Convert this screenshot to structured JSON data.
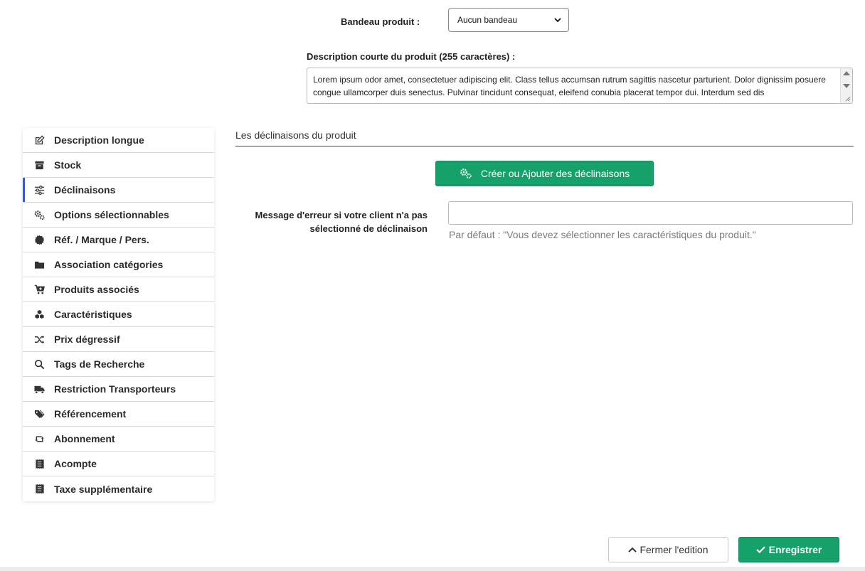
{
  "form": {
    "banner_label": "Bandeau produit :",
    "banner_value": "Aucun bandeau",
    "short_desc_label": "Description courte du produit (255 caractères) :",
    "short_desc_value": "Lorem ipsum odor amet, consectetuer adipiscing elit. Class tellus accumsan rutrum sagittis nascetur parturient. Dolor dignissim posuere congue ullamcorper duis senectus. Pulvinar tincidunt consequat, eleifend conubia placerat tempor dui. Interdum sed dis"
  },
  "sidebar": {
    "items": [
      {
        "label": "Description longue",
        "icon": "edit-icon"
      },
      {
        "label": "Stock",
        "icon": "archive-icon"
      },
      {
        "label": "Déclinaisons",
        "icon": "sliders-icon"
      },
      {
        "label": "Options sélectionnables",
        "icon": "cogs-icon"
      },
      {
        "label": "Réf. / Marque / Pers.",
        "icon": "certificate-icon"
      },
      {
        "label": "Association catégories",
        "icon": "folder-icon"
      },
      {
        "label": "Produits associés",
        "icon": "cart-plus-icon"
      },
      {
        "label": "Caractéristiques",
        "icon": "cubes-icon"
      },
      {
        "label": "Prix dégressif",
        "icon": "shuffle-icon"
      },
      {
        "label": "Tags de Recherche",
        "icon": "search-icon"
      },
      {
        "label": "Restriction Transporteurs",
        "icon": "truck-icon"
      },
      {
        "label": "Référencement",
        "icon": "tags-icon"
      },
      {
        "label": "Abonnement",
        "icon": "retweet-icon"
      },
      {
        "label": "Acompte",
        "icon": "receipt-icon"
      },
      {
        "label": "Taxe supplémentaire",
        "icon": "receipt-icon"
      }
    ],
    "active_index": 2
  },
  "section": {
    "title": "Les déclinaisons du produit",
    "create_button_label": "Créer ou Ajouter des déclinaisons",
    "error_message_label": "Message d'erreur si votre client n'a pas sélectionné de déclinaison",
    "error_message_value": "",
    "error_message_help": "Par défaut : \"Vous devez sélectionner les caractéristiques du produit.\""
  },
  "footer": {
    "close_label": "Fermer l'edition",
    "save_label": "Enregistrer"
  },
  "colors": {
    "accent_green": "#16a06a",
    "active_marker": "#3a5bc7"
  }
}
